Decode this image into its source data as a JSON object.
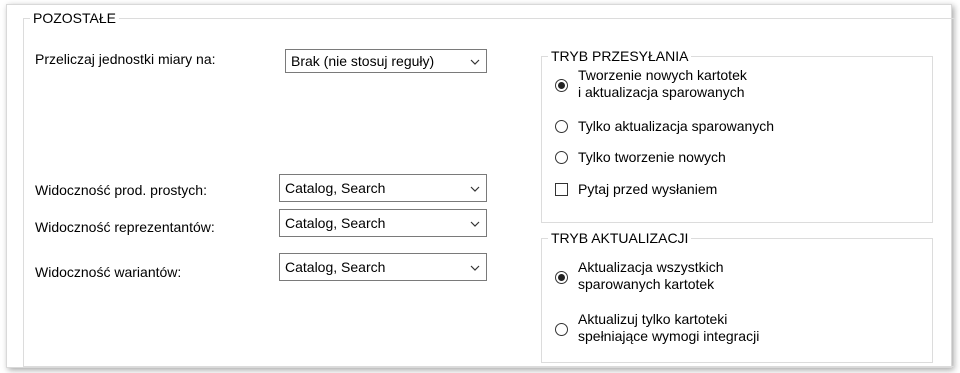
{
  "panel": {
    "title": "POZOSTAŁE",
    "units": {
      "label": "Przeliczaj jednostki miary na:",
      "value": "Brak (nie stosuj reguły)"
    },
    "simple_visibility": {
      "label": "Widoczność prod. prostych:",
      "value": "Catalog, Search"
    },
    "representatives_visibility": {
      "label": "Widoczność reprezentantów:",
      "value": "Catalog, Search"
    },
    "variants_visibility": {
      "label": "Widoczność wariantów:",
      "value": "Catalog, Search"
    }
  },
  "transfer_mode": {
    "title": "TRYB PRZESYŁANIA",
    "options": [
      {
        "line1": "Tworzenie nowych kartotek",
        "line2": "i aktualizacja sparowanych",
        "checked": true
      },
      {
        "line1": "Tylko aktualizacja sparowanych",
        "line2": "",
        "checked": false
      },
      {
        "line1": "Tylko tworzenie nowych",
        "line2": "",
        "checked": false
      }
    ],
    "ask_before_send": {
      "label": "Pytaj przed wysłaniem",
      "checked": false
    }
  },
  "update_mode": {
    "title": "TRYB AKTUALIZACJI",
    "options": [
      {
        "line1": "Aktualizacja wszystkich",
        "line2": "sparowanych kartotek",
        "checked": true
      },
      {
        "line1": "Aktualizuj tylko kartoteki",
        "line2": "spełniające wymogi integracji",
        "checked": false
      }
    ]
  },
  "icons": {
    "dropdown": "chevron-down-icon"
  }
}
